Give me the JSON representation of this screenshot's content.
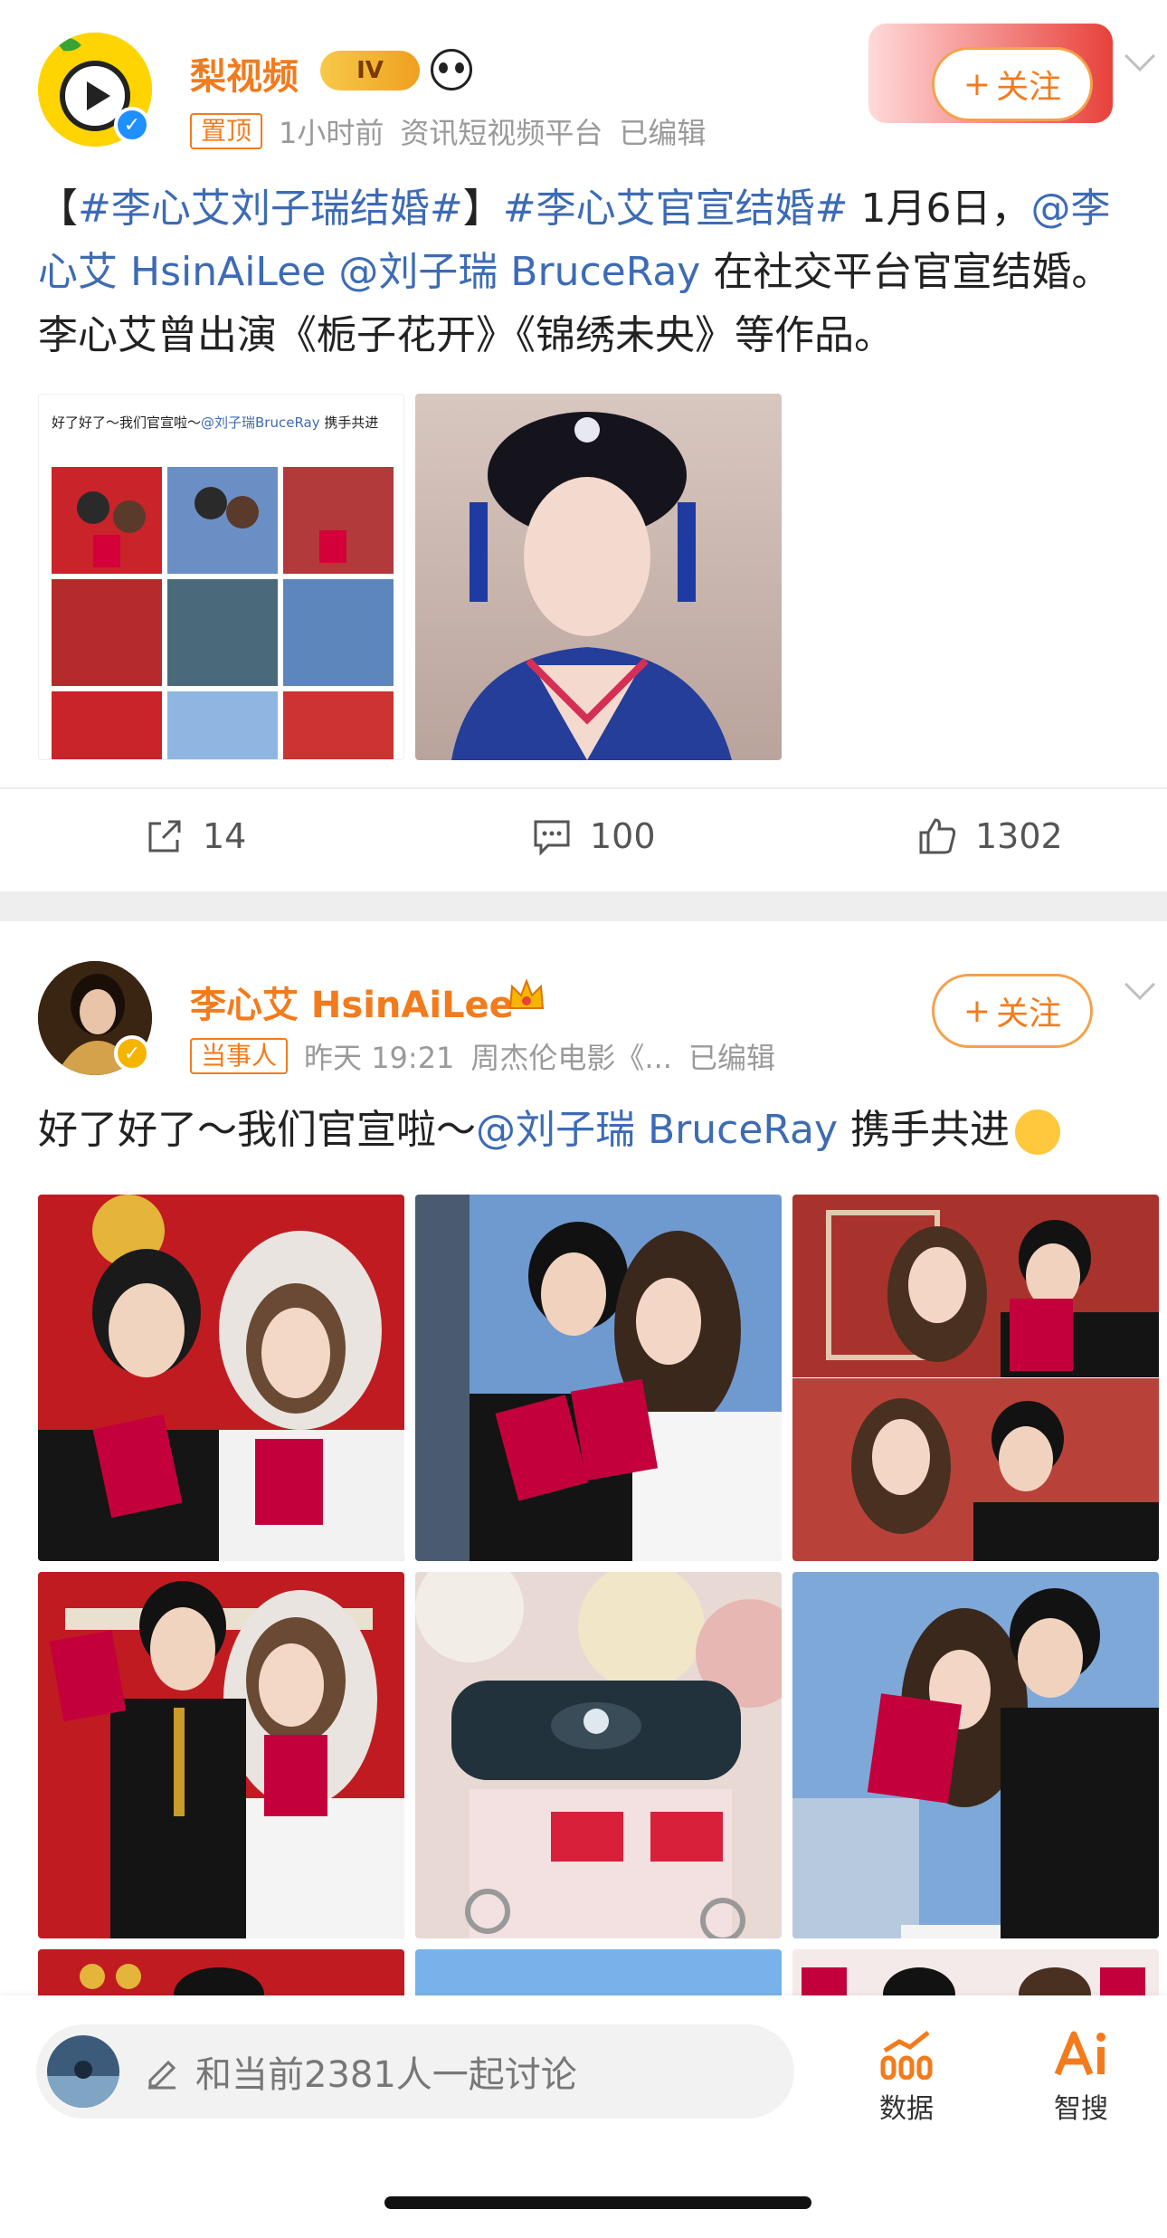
{
  "post1": {
    "author": "梨视频",
    "level_badge": "IV",
    "pin_tag": "置顶",
    "time": "1小时前",
    "source": "资讯短视频平台",
    "edited": "已编辑",
    "follow_label": "关注",
    "text_parts": {
      "p1": "【",
      "hashtag1": "#李心艾刘子瑞结婚#",
      "p2": "】",
      "hashtag2": "#李心艾官宣结婚#",
      "p3": " 1月6日，",
      "mention1": "@李心艾 HsinAiLee",
      "p4": " ",
      "mention2": "@刘子瑞 BruceRay",
      "p5": " 在社交平台官宣结婚。李心艾曾出演《栀子花开》《锦绣未央》等作品。"
    },
    "screenshot_caption_prefix": "好了好了～我们官宣啦～",
    "screenshot_caption_mention": "@刘子瑞BruceRay",
    "screenshot_caption_suffix": " 携手共进",
    "repost_count": "14",
    "comment_count": "100",
    "like_count": "1302"
  },
  "post2": {
    "author": "李心艾 HsinAiLee",
    "tag": "当事人",
    "time": "昨天 19:21",
    "source": "周杰伦电影《...",
    "edited": "已编辑",
    "follow_label": "关注",
    "text_prefix": "好了好了～我们官宣啦～",
    "mention": "@刘子瑞 BruceRay",
    "text_suffix": " 携手共进"
  },
  "bottombar": {
    "comment_placeholder": "和当前2381人一起讨论",
    "data_label": "数据",
    "ai_label": "智搜"
  },
  "colors": {
    "accent": "#f27b1d",
    "link": "#3d6bb5",
    "marriage_red": "#c8102e"
  }
}
